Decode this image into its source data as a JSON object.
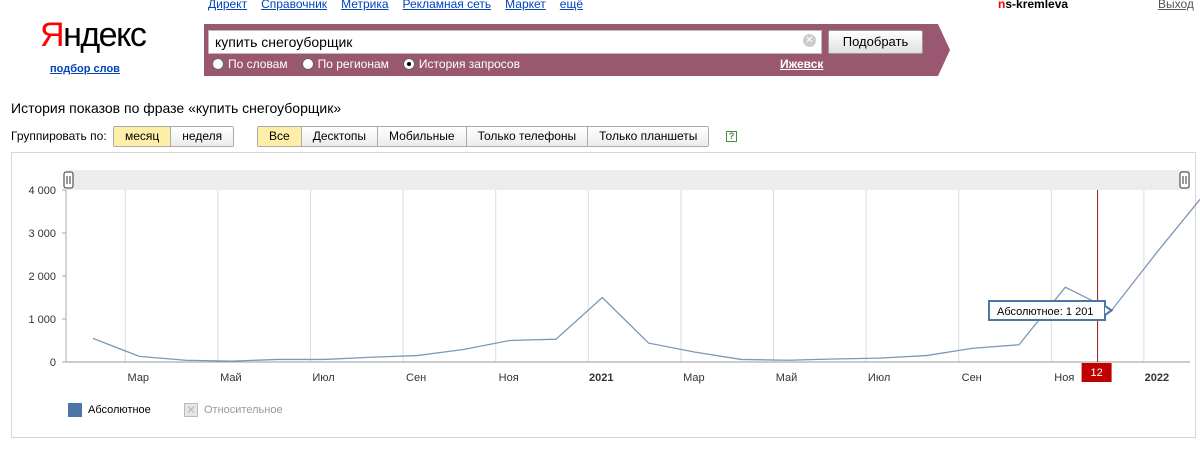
{
  "header": {
    "logo_first": "Я",
    "logo_rest": "ндекс",
    "podbor_link": "подбор слов",
    "nav": [
      "Директ",
      "Справочник",
      "Метрика",
      "Рекламная сеть",
      "Маркет",
      "ещё"
    ],
    "user_first": "n",
    "user_rest": "s-kremleva",
    "logout": "Выход"
  },
  "search": {
    "value": "купить снегоуборщик",
    "button_label": "Подобрать",
    "radios": [
      {
        "label": "По словам",
        "selected": false
      },
      {
        "label": "По регионам",
        "selected": false
      },
      {
        "label": "История запросов",
        "selected": true
      }
    ],
    "region": "Ижевск"
  },
  "page": {
    "title": "История показов по фразе «купить снегоуборщик»",
    "group_label": "Группировать по:",
    "group_buttons": [
      {
        "label": "месяц",
        "active": true
      },
      {
        "label": "неделя",
        "active": false
      }
    ],
    "device_buttons": [
      {
        "label": "Все",
        "active": true
      },
      {
        "label": "Десктопы",
        "active": false
      },
      {
        "label": "Мобильные",
        "active": false
      },
      {
        "label": "Только телефоны",
        "active": false
      },
      {
        "label": "Только планшеты",
        "active": false
      }
    ],
    "help": "?"
  },
  "chart_data": {
    "type": "line",
    "y_ticks": [
      "0",
      "1 000",
      "2 000",
      "3 000",
      "4 000"
    ],
    "ylim": [
      0,
      4000
    ],
    "x_ticks": [
      {
        "label": "Мар",
        "bold": false
      },
      {
        "label": "Май",
        "bold": false
      },
      {
        "label": "Июл",
        "bold": false
      },
      {
        "label": "Сен",
        "bold": false
      },
      {
        "label": "Ноя",
        "bold": false
      },
      {
        "label": "2021",
        "bold": true
      },
      {
        "label": "Мар",
        "bold": false
      },
      {
        "label": "Май",
        "bold": false
      },
      {
        "label": "Июл",
        "bold": false
      },
      {
        "label": "Сен",
        "bold": false
      },
      {
        "label": "Ноя",
        "bold": false
      },
      {
        "label": "2022",
        "bold": true
      }
    ],
    "series": [
      {
        "values": [
          550,
          130,
          40,
          20,
          60,
          60,
          110,
          150,
          290,
          500,
          530,
          1500,
          440,
          230,
          60,
          40,
          70,
          90,
          150,
          320,
          400,
          1740,
          1201,
          2580,
          3900
        ],
        "color": "#7d98b8"
      }
    ],
    "tooltip": "Абсолютное: 1 201",
    "marker_label": "12",
    "marker_index": 22,
    "legend": [
      {
        "label": "Абсолютное",
        "color": "#4d76a8",
        "active": true
      },
      {
        "label": "Относительное",
        "color": "#cccccc",
        "active": false
      }
    ]
  }
}
